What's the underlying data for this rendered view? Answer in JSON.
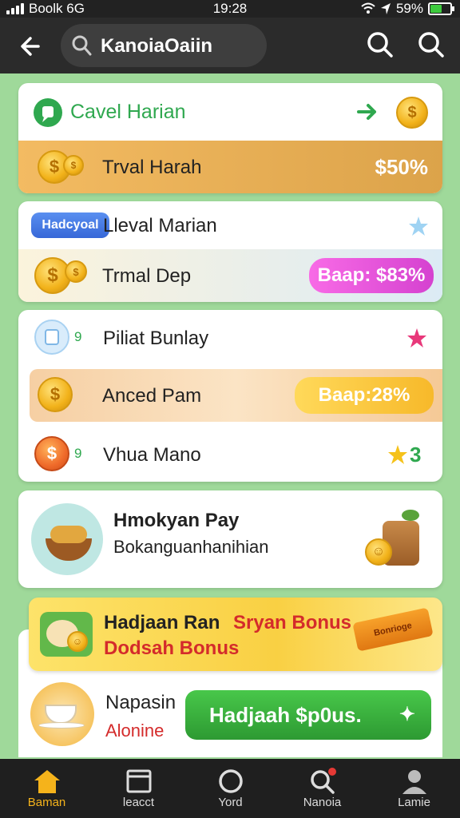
{
  "status_bar": {
    "carrier": "Boolk 6G",
    "time": "19:28",
    "battery": "59%",
    "battery_level": 0.59
  },
  "app_bar": {
    "search_text": "KanoiaOaiin"
  },
  "card1": {
    "title": "Cavel Harian",
    "row_label": "Trval Harah",
    "row_value": "$50%"
  },
  "card2": {
    "badge": "Hadcyoal",
    "title": "Lleval Marian",
    "row_label": "Trmal Dep",
    "pill": "Baap: $83%"
  },
  "card3": {
    "row1_label": "Piliat Bunlay",
    "row2_label": "Anced Pam",
    "row2_pill": "Baap:28%",
    "row3_label": "Vhua Mano",
    "row3_count": "3",
    "marker": "9"
  },
  "card4": {
    "title": "Hmokyan Pay",
    "subtitle": "Bokanguanhanihian"
  },
  "card5": {
    "title_black": "Hadjaan Ran",
    "title_red": "Sryan Bonus",
    "subtitle": "Dodsah Bonus",
    "ribbon": "Bonrioge"
  },
  "card6": {
    "title": "Napasin",
    "subtitle": "Alonine",
    "button": "Hadjaah $p0us."
  },
  "nav": [
    {
      "label": "Baman",
      "icon": "home-icon"
    },
    {
      "label": "leacct",
      "icon": "window-icon"
    },
    {
      "label": "Yord",
      "icon": "circle-icon"
    },
    {
      "label": "Nanoia",
      "icon": "search-icon"
    },
    {
      "label": "Lamie",
      "icon": "profile-icon"
    }
  ],
  "colors": {
    "accent_green": "#2fa84f",
    "gold": "#f2b21a",
    "pink": "#e64bd6",
    "red": "#d42b2b"
  }
}
